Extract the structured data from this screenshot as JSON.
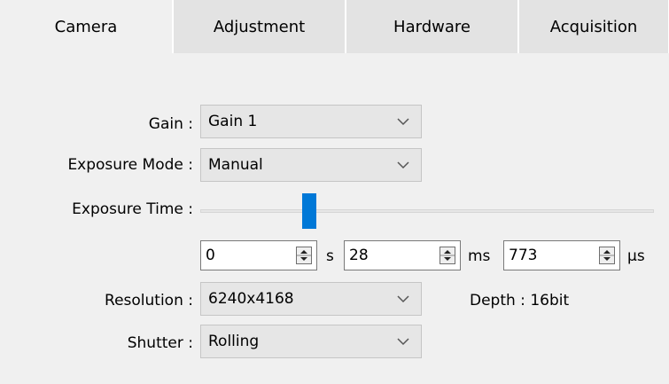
{
  "tabs": [
    {
      "label": "Camera",
      "active": true
    },
    {
      "label": "Adjustment",
      "active": false
    },
    {
      "label": "Hardware",
      "active": false
    },
    {
      "label": "Acquisition",
      "active": false
    }
  ],
  "camera": {
    "gain": {
      "label": "Gain :",
      "value": "Gain 1"
    },
    "exposure_mode": {
      "label": "Exposure Mode :",
      "value": "Manual"
    },
    "exposure_time": {
      "label": "Exposure Time :",
      "slider_level": 0.23,
      "seconds": {
        "value": "0",
        "unit": "s"
      },
      "milliseconds": {
        "value": "28",
        "unit": "ms"
      },
      "microseconds": {
        "value": "773",
        "unit": "µs"
      }
    },
    "resolution": {
      "label": "Resolution :",
      "value": "6240x4168"
    },
    "depth": {
      "text": "Depth : 16bit"
    },
    "shutter": {
      "label": "Shutter :",
      "value": "Rolling"
    }
  },
  "colors": {
    "accent": "#0078d7",
    "panel": "#f0f0f0",
    "tab_inactive": "#e3e3e3"
  },
  "icons": {
    "dropdown": "chevron-down-icon",
    "spinner": "spinner-up-down-icon"
  }
}
